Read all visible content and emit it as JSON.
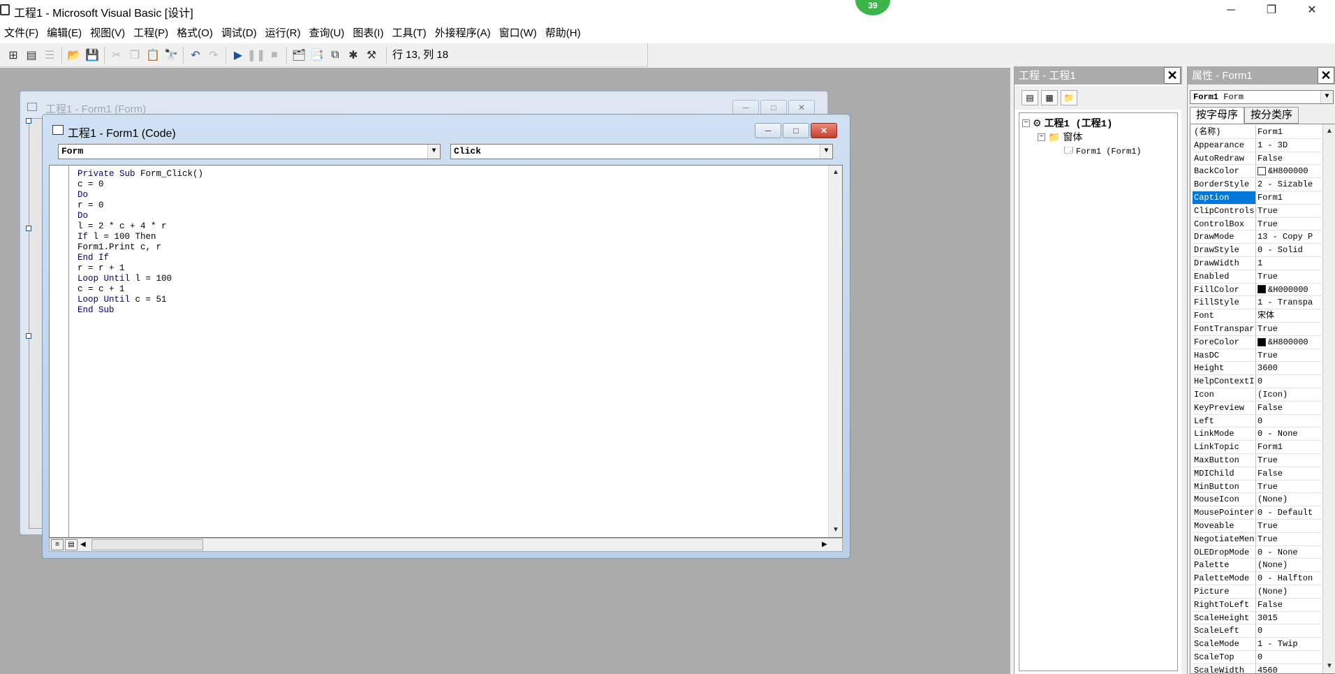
{
  "app": {
    "title": "工程1 - Microsoft Visual Basic [设计]",
    "badge": "39",
    "window_controls": {
      "minimize": "─",
      "restore": "❐",
      "close": "✕"
    }
  },
  "menu": [
    "文件(F)",
    "编辑(E)",
    "视图(V)",
    "工程(P)",
    "格式(O)",
    "调试(D)",
    "运行(R)",
    "查询(U)",
    "图表(I)",
    "工具(T)",
    "外接程序(A)",
    "窗口(W)",
    "帮助(H)"
  ],
  "toolbar": {
    "status": "行 13, 列 18",
    "icons": [
      "add-project-icon",
      "add-form-icon",
      "menu-editor-icon",
      "open-icon",
      "save-icon",
      "cut-icon",
      "copy-icon",
      "paste-icon",
      "find-icon",
      "undo-icon",
      "redo-icon",
      "run-icon",
      "pause-icon",
      "stop-icon",
      "project-explorer-icon",
      "properties-window-icon",
      "form-layout-icon",
      "object-browser-icon",
      "toolbox-icon"
    ]
  },
  "form_window": {
    "title": "工程1 - Form1 (Form)"
  },
  "code_window": {
    "title": "工程1 - Form1 (Code)",
    "object_combo": "Form",
    "procedure_combo": "Click",
    "lines": [
      {
        "kw": "Private Sub",
        "text": " Form_Click()"
      },
      {
        "kw": "",
        "text": "c = 0"
      },
      {
        "kw": "Do",
        "text": ""
      },
      {
        "kw": "",
        "text": "r = 0"
      },
      {
        "kw": "Do",
        "text": ""
      },
      {
        "kw": "",
        "text": "l = 2 * c + 4 * r"
      },
      {
        "kw": "If",
        "text": " l = 100 Then"
      },
      {
        "kw": "",
        "text": "Form1.Print c, r"
      },
      {
        "kw": "End If",
        "text": ""
      },
      {
        "kw": "",
        "text": "r = r + 1"
      },
      {
        "kw": "Loop Until",
        "text": " l = 100"
      },
      {
        "kw": "",
        "text": "c = c + 1"
      },
      {
        "kw": "Loop Until",
        "text": " c = 51"
      },
      {
        "kw": "End Sub",
        "text": ""
      }
    ]
  },
  "project_panel": {
    "title": "工程 - 工程1",
    "tree": {
      "root": "工程1 (工程1)",
      "folder": "窗体",
      "item": "Form1 (Form1)"
    }
  },
  "properties_panel": {
    "title": "属性 - Form1",
    "object_bold": "Form1",
    "object_type": "Form",
    "tabs": [
      "按字母序",
      "按分类序"
    ],
    "selected": "Caption",
    "rows": [
      {
        "name": "(名称)",
        "value": "Form1"
      },
      {
        "name": "Appearance",
        "value": "1 - 3D"
      },
      {
        "name": "AutoRedraw",
        "value": "False"
      },
      {
        "name": "BackColor",
        "value": "&H800000",
        "swatch": "#ffffff"
      },
      {
        "name": "BorderStyle",
        "value": "2 - Sizable"
      },
      {
        "name": "Caption",
        "value": "Form1"
      },
      {
        "name": "ClipControls",
        "value": "True"
      },
      {
        "name": "ControlBox",
        "value": "True"
      },
      {
        "name": "DrawMode",
        "value": "13 - Copy P"
      },
      {
        "name": "DrawStyle",
        "value": "0 - Solid"
      },
      {
        "name": "DrawWidth",
        "value": "1"
      },
      {
        "name": "Enabled",
        "value": "True"
      },
      {
        "name": "FillColor",
        "value": "&H000000",
        "swatch": "#000000"
      },
      {
        "name": "FillStyle",
        "value": "1 - Transpa"
      },
      {
        "name": "Font",
        "value": "宋体"
      },
      {
        "name": "FontTranspar",
        "value": "True"
      },
      {
        "name": "ForeColor",
        "value": "&H800000",
        "swatch": "#000000"
      },
      {
        "name": "HasDC",
        "value": "True"
      },
      {
        "name": "Height",
        "value": "3600"
      },
      {
        "name": "HelpContextI",
        "value": "0"
      },
      {
        "name": "Icon",
        "value": "(Icon)"
      },
      {
        "name": "KeyPreview",
        "value": "False"
      },
      {
        "name": "Left",
        "value": "0"
      },
      {
        "name": "LinkMode",
        "value": "0 - None"
      },
      {
        "name": "LinkTopic",
        "value": "Form1"
      },
      {
        "name": "MaxButton",
        "value": "True"
      },
      {
        "name": "MDIChild",
        "value": "False"
      },
      {
        "name": "MinButton",
        "value": "True"
      },
      {
        "name": "MouseIcon",
        "value": "(None)"
      },
      {
        "name": "MousePointer",
        "value": "0 - Default"
      },
      {
        "name": "Moveable",
        "value": "True"
      },
      {
        "name": "NegotiateMen",
        "value": "True"
      },
      {
        "name": "OLEDropMode",
        "value": "0 - None"
      },
      {
        "name": "Palette",
        "value": "(None)"
      },
      {
        "name": "PaletteMode",
        "value": "0 - Halfton"
      },
      {
        "name": "Picture",
        "value": "(None)"
      },
      {
        "name": "RightToLeft",
        "value": "False"
      },
      {
        "name": "ScaleHeight",
        "value": "3015"
      },
      {
        "name": "ScaleLeft",
        "value": "0"
      },
      {
        "name": "ScaleMode",
        "value": "1 - Twip"
      },
      {
        "name": "ScaleTop",
        "value": "0"
      },
      {
        "name": "ScaleWidth",
        "value": "4560"
      }
    ]
  }
}
